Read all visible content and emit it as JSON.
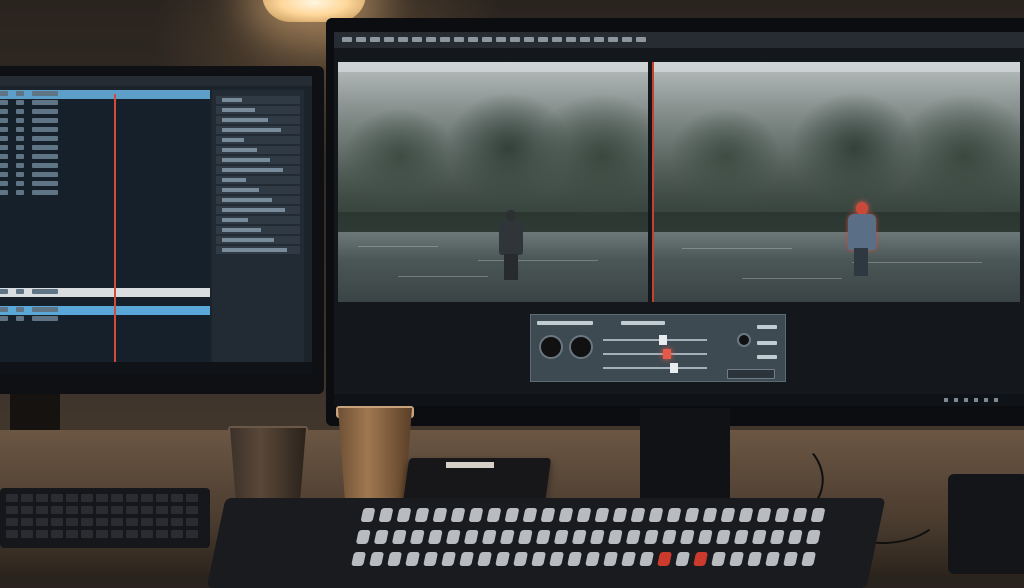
{
  "scene": {
    "description_tag": "",
    "colors": {
      "playhead": "#c6412e",
      "highlight_row": "#5d9fc8",
      "lamp_light": "#ffd79a",
      "subject_red": "#c94a3a"
    }
  },
  "icons": [
    "lamp-icon",
    "knob-icon",
    "slider-icon"
  ],
  "control_panel": {
    "slider_levels": [
      0.58,
      0.62,
      0.68
    ]
  }
}
